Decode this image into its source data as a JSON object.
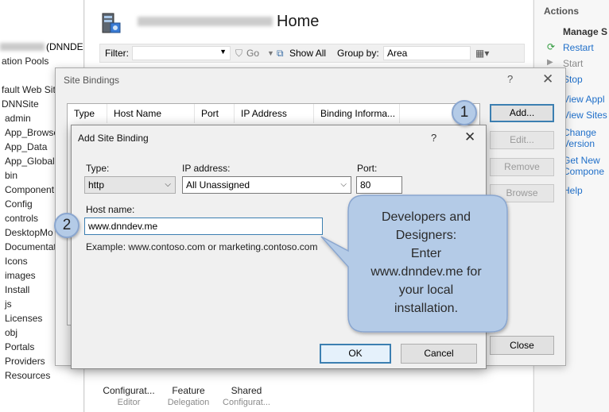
{
  "iis": {
    "page_title": "Home",
    "server_suffix": "(DNNDES",
    "tree": [
      "ation Pools",
      "fault Web Site",
      "DNNSite",
      "admin",
      "App_Browse",
      "App_Data",
      "App_GlobalR",
      "bin",
      "Component",
      "Config",
      "controls",
      "DesktopMo",
      "Documentat",
      "Icons",
      "images",
      "Install",
      "js",
      "Licenses",
      "obj",
      "Portals",
      "Providers",
      "Resources"
    ],
    "filter": {
      "label": "Filter:",
      "go": "Go",
      "show_all": "Show All",
      "group_by_label": "Group by:",
      "group_by_value": "Area"
    },
    "bottom_icons": [
      {
        "label": "Configurat...",
        "sub": "Editor"
      },
      {
        "label": "Feature",
        "sub": "Delegation"
      },
      {
        "label": "Shared",
        "sub": "Configurat..."
      }
    ],
    "actions": {
      "title": "Actions",
      "section": "Manage S",
      "items": [
        {
          "label": "Restart",
          "enabled": true,
          "icon": "refresh-icon"
        },
        {
          "label": "Start",
          "enabled": false,
          "icon": "play-icon"
        },
        {
          "label": "Stop",
          "enabled": true,
          "icon": "stop-icon"
        },
        {
          "label": "View Appl",
          "enabled": true,
          "icon": ""
        },
        {
          "label": "View Sites",
          "enabled": true,
          "icon": ""
        },
        {
          "label": "Change",
          "enabled": true,
          "icon": ""
        },
        {
          "label": "Version",
          "enabled": true,
          "icon": ""
        },
        {
          "label": "Get New",
          "enabled": true,
          "icon": ""
        },
        {
          "label": "Compone",
          "enabled": true,
          "icon": ""
        },
        {
          "label": "Help",
          "enabled": true,
          "icon": "help-icon"
        }
      ]
    }
  },
  "site_bindings": {
    "title": "Site Bindings",
    "help_glyph": "?",
    "close_glyph": "✕",
    "columns": [
      "Type",
      "Host Name",
      "Port",
      "IP Address",
      "Binding Informa..."
    ],
    "buttons": {
      "add": "Add...",
      "edit": "Edit...",
      "remove": "Remove",
      "browse": "Browse",
      "close": "Close"
    }
  },
  "add_site_binding": {
    "title": "Add Site Binding",
    "help_glyph": "?",
    "close_glyph": "✕",
    "type_label": "Type:",
    "type_value": "http",
    "ip_label": "IP address:",
    "ip_value": "All Unassigned",
    "port_label": "Port:",
    "port_value": "80",
    "host_label": "Host name:",
    "host_value": "www.dnndev.me",
    "example": "Example: www.contoso.com or marketing.contoso.com",
    "ok": "OK",
    "cancel": "Cancel"
  },
  "callouts": {
    "badge1": "1",
    "badge2": "2",
    "tip_lines": [
      "Developers and",
      "Designers:",
      "Enter",
      "www.dnndev.me for",
      "your local",
      "installation."
    ],
    "bubble_color": "#b4cbe7",
    "bubble_border": "#8aa6cf"
  }
}
